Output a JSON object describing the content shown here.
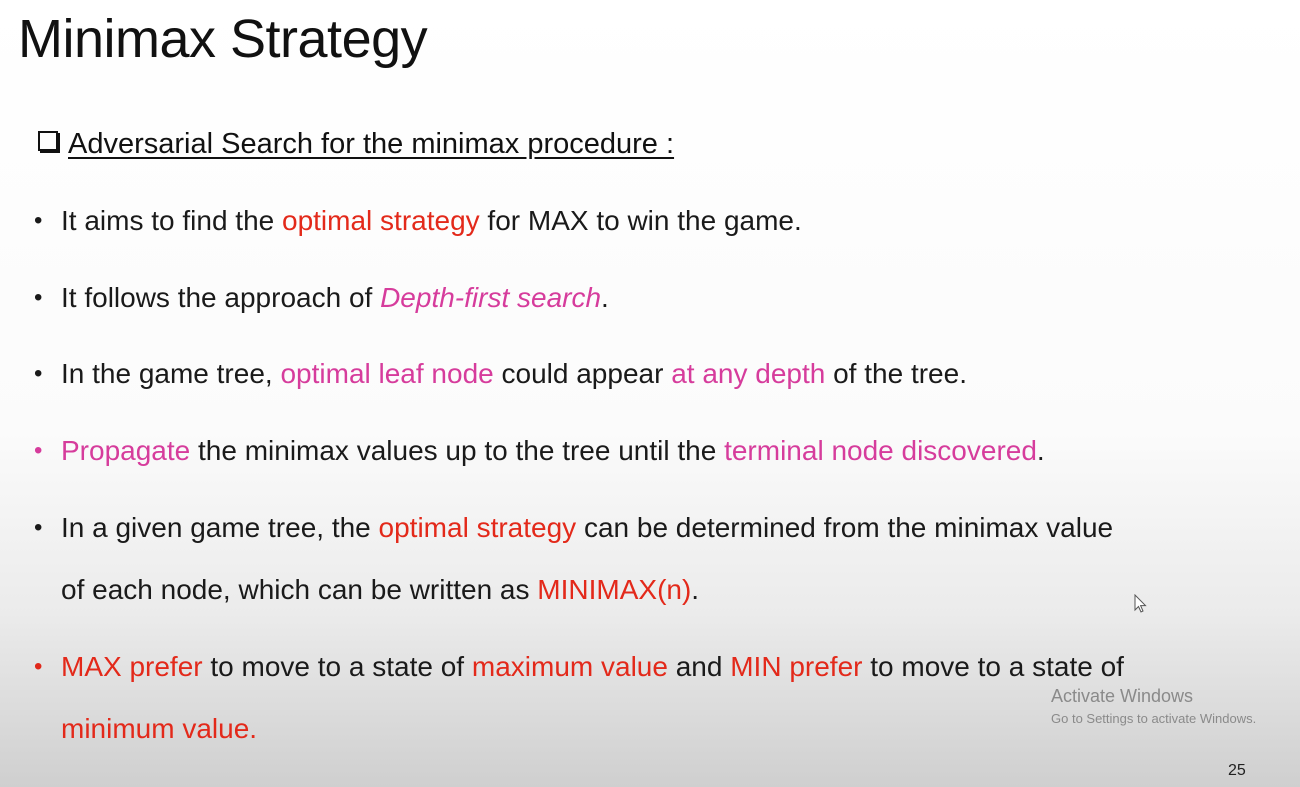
{
  "title": "Minimax Strategy",
  "subheading": "Adversarial Search for the minimax procedure :",
  "bullets": [
    {
      "p1": "It aims to find the ",
      "h1": "optimal strategy",
      "p2": " for MAX to win the game."
    },
    {
      "p1": "It follows the approach of ",
      "h1": "Depth-first search",
      "p2": "."
    },
    {
      "p1": "In the game tree, ",
      "h1": "optimal leaf node",
      "p2": " could appear ",
      "h2": "at any depth",
      "p3": " of the tree."
    },
    {
      "h1": "Propagate",
      "p1": " the minimax values up to the tree until the ",
      "h2": "terminal node discovered",
      "p2": "."
    },
    {
      "p1": "In a given game tree, the ",
      "h1": "optimal strategy",
      "p2": " can be determined from the minimax value",
      "p3": "of each node, which can be written as ",
      "h2": "MINIMAX(n)",
      "p4": "."
    },
    {
      "h1": "MAX prefer",
      "p1": " to move to a state of ",
      "h2": "maximum value",
      "p2": " and ",
      "h3": "MIN prefer",
      "p3": " to move to a state of",
      "h4": "minimum value."
    }
  ],
  "watermark": {
    "line1": "Activate Windows",
    "line2": "Go to Settings to activate Windows."
  },
  "page_number": "25",
  "colors": {
    "red": "#e3291a",
    "pink": "#d63c9c"
  }
}
